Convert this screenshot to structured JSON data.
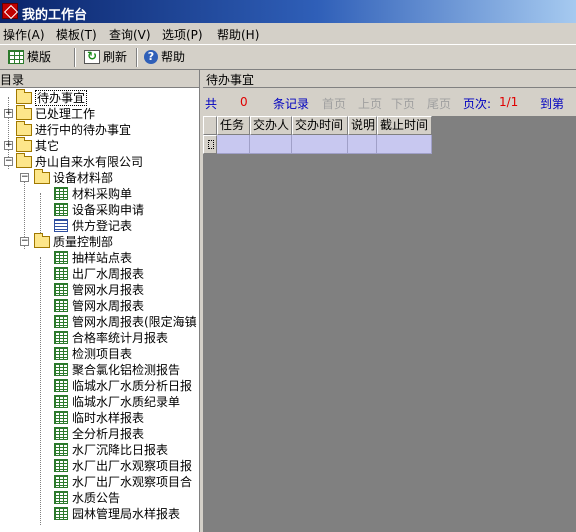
{
  "window": {
    "title": "我的工作台"
  },
  "menu": [
    "操作(A)",
    "模板(T)",
    "查询(V)",
    "选项(P)",
    "帮助(H)"
  ],
  "toolbar": {
    "template": "模版",
    "refresh": "刷新",
    "help": "帮助"
  },
  "left_pane": {
    "header": "目录",
    "tree": [
      {
        "label": "待办事宜",
        "icon": "folder-icon",
        "selected": true
      },
      {
        "label": "已处理工作",
        "icon": "folder-icon"
      },
      {
        "label": "进行中的待办事宜",
        "icon": "folder-icon"
      },
      {
        "label": "其它",
        "icon": "folder-icon"
      },
      {
        "label": "舟山自来水有限公司",
        "icon": "folder-icon"
      },
      {
        "label": "设备材料部",
        "icon": "folder-icon"
      },
      {
        "label": "材料采购单",
        "icon": "sheet-icon"
      },
      {
        "label": "设备采购申请",
        "icon": "sheet-icon"
      },
      {
        "label": "供方登记表",
        "icon": "form-icon"
      },
      {
        "label": "质量控制部",
        "icon": "folder-icon"
      },
      {
        "label": "抽样站点表",
        "icon": "sheet-icon"
      },
      {
        "label": "出厂水周报表",
        "icon": "sheet-icon"
      },
      {
        "label": "管网水月报表",
        "icon": "sheet-icon"
      },
      {
        "label": "管网水周报表",
        "icon": "sheet-icon"
      },
      {
        "label": "管网水周报表(限定海镇",
        "icon": "sheet-icon"
      },
      {
        "label": "合格率统计月报表",
        "icon": "sheet-icon"
      },
      {
        "label": "检测项目表",
        "icon": "sheet-icon"
      },
      {
        "label": "聚合氯化铝检测报告",
        "icon": "sheet-icon"
      },
      {
        "label": "临城水厂水质分析日报",
        "icon": "sheet-icon"
      },
      {
        "label": "临城水厂水质纪录单",
        "icon": "sheet-icon"
      },
      {
        "label": "临时水样报表",
        "icon": "sheet-icon"
      },
      {
        "label": "全分析月报表",
        "icon": "sheet-icon"
      },
      {
        "label": "水厂沉降比日报表",
        "icon": "sheet-icon"
      },
      {
        "label": "水厂出厂水观察项目报",
        "icon": "sheet-icon"
      },
      {
        "label": "水厂出厂水观察项目合",
        "icon": "sheet-icon"
      },
      {
        "label": "水质公告",
        "icon": "sheet-icon"
      },
      {
        "label": "园林管理局水样报表",
        "icon": "sheet-icon"
      }
    ]
  },
  "right_pane": {
    "header": "待办事宜",
    "pager": {
      "total_prefix": "共",
      "total_count": "0",
      "total_suffix": "条记录",
      "first": "首页",
      "prev": "上页",
      "next": "下页",
      "last": "尾页",
      "page_label": "页次:",
      "page_value": "1/1",
      "goto": "到第"
    },
    "columns": [
      "任务",
      "交办人",
      "交办时间",
      "说明",
      "截止时间"
    ]
  }
}
